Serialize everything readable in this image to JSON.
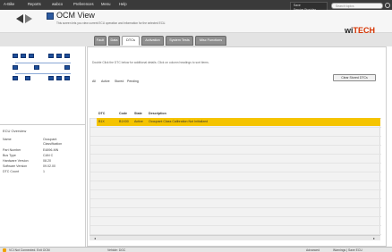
{
  "menu": {
    "items": [
      "A-Bike",
      "Reports",
      "wabco",
      "Preferences",
      "Menu",
      "Help"
    ]
  },
  "logo": {
    "line1": "Save",
    "line2": "Service Provider"
  },
  "search": {
    "placeholder": "Search topics"
  },
  "header": {
    "title": "OCM View",
    "subtitle": "This screen lets you view current ECU operation and information for the selected ECU.",
    "brand_left": "wi",
    "brand_right": "TECH"
  },
  "tabs": [
    {
      "label": "Fault"
    },
    {
      "label": "Data"
    },
    {
      "label": "DTCs"
    },
    {
      "label": "Activation"
    },
    {
      "label": "System Tests"
    },
    {
      "label": "Misc Functions"
    }
  ],
  "left_panel": {
    "title": "ECU Overview",
    "fields": [
      {
        "label": "Name",
        "value": "Occupant"
      },
      {
        "label": "",
        "value": "Classification"
      },
      {
        "label": "Part Number",
        "value": "E4896-MN"
      },
      {
        "label": "Bus Type",
        "value": "CAN C"
      },
      {
        "label": "Hardware Version",
        "value": "08.20"
      },
      {
        "label": "Software Version",
        "value": "09.02.00"
      },
      {
        "label": "DTC Count",
        "value": "1"
      }
    ]
  },
  "content": {
    "description": "Double Click the DTC below for additional details. Click on column headings to sort items.",
    "clear_button": "Clear Stored DTCs",
    "toolbar": [
      "All",
      "Active",
      "Stored",
      "Pending"
    ]
  },
  "table": {
    "columns": [
      "DTC",
      "Code",
      "State",
      "Description"
    ],
    "rows": [
      {
        "dtc": "B1X",
        "code": "B1X00",
        "state": "Active",
        "description": "Occupant Class Calibration Not Initialized"
      }
    ]
  },
  "status": {
    "left": "VCI Not Connected. Exit OCM",
    "middle": "Vehicle: DGC",
    "right1": "Advanced",
    "right2": "Warnings | Save ECU"
  },
  "colors": {
    "selected_row": "#f5c400",
    "brand_accent": "#d63300",
    "menu_bar": "#3a3a3a"
  }
}
